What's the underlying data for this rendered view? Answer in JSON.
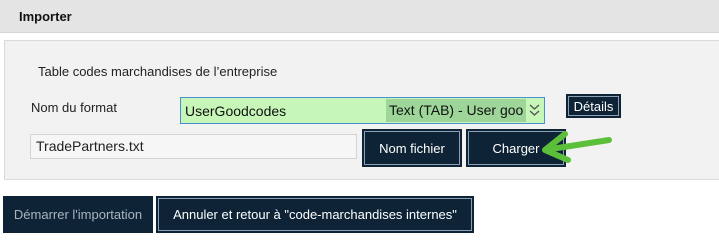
{
  "header": {
    "title": "Importer"
  },
  "form": {
    "section_label": "Table codes marchandises de l’entreprise",
    "format_label": "Nom du format",
    "format_select": {
      "name": "UserGoodcodes",
      "type": "Text (TAB) - User goo",
      "icon": "chevron-down-icon"
    },
    "details_label": "Détails",
    "file_input_value": "TradePartners.txt",
    "file_button_label": "Nom fichier",
    "load_button_label": "Charger"
  },
  "actions": {
    "start_label": "Démarrer l'importation",
    "cancel_label": "Annuler et retour à \"code-marchandises internes\""
  },
  "annotation": {
    "icon": "arrow-left-icon",
    "color": "#5cbf3a"
  },
  "colors": {
    "button_bg": "#0e2436",
    "select_bg": "#c7f7b8",
    "select_type_bg": "#9ed69a",
    "select_border": "#4a8fd0"
  }
}
